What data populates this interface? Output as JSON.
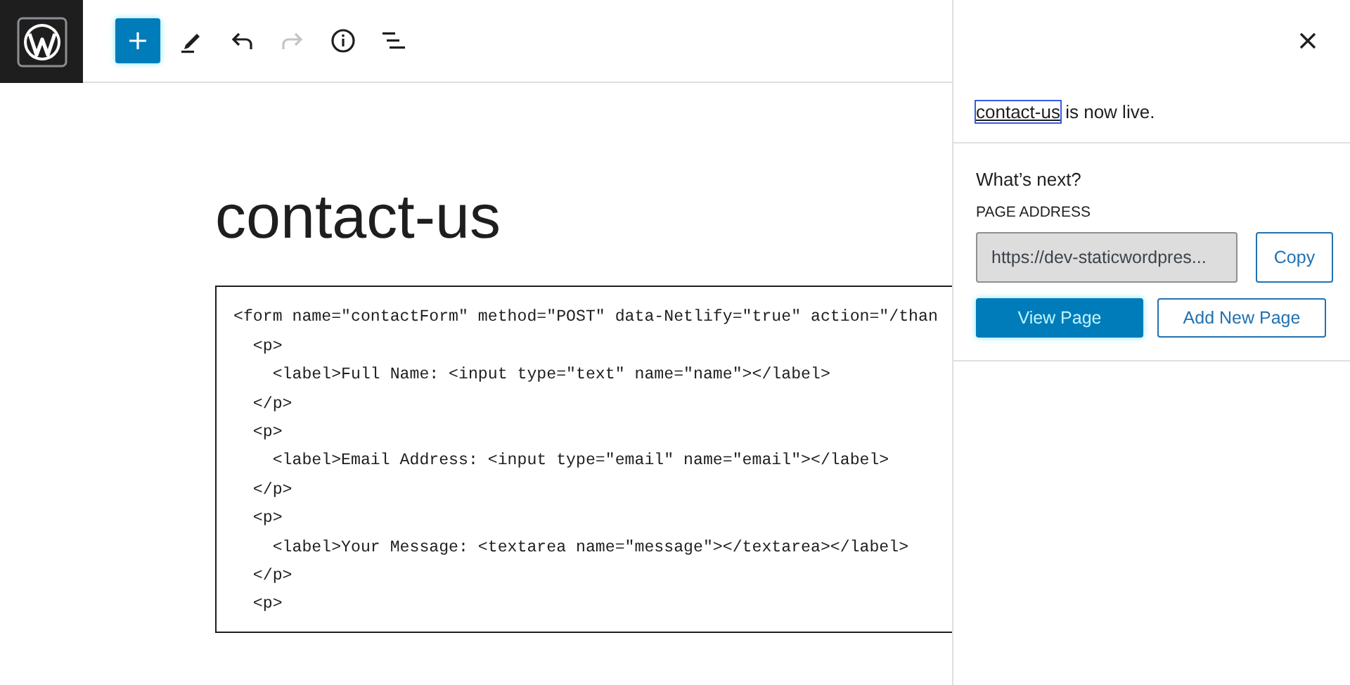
{
  "toolbar": {
    "tools": [
      {
        "kind": "add",
        "disabled": false
      },
      {
        "kind": "edit",
        "disabled": false
      },
      {
        "kind": "undo",
        "disabled": false
      },
      {
        "kind": "redo",
        "disabled": true
      },
      {
        "kind": "info",
        "disabled": false
      },
      {
        "kind": "list",
        "disabled": false
      }
    ]
  },
  "editor": {
    "title": "contact-us",
    "code_lines": [
      "<form name=\"contactForm\" method=\"POST\" data-Netlify=\"true\" action=\"/than",
      "  <p>",
      "    <label>Full Name: <input type=\"text\" name=\"name\"></label>",
      "  </p>",
      "  <p>",
      "    <label>Email Address: <input type=\"email\" name=\"email\"></label>",
      "  </p>",
      "  <p>",
      "    <label>Your Message: <textarea name=\"message\"></textarea></label>",
      "  </p>",
      "  <p>"
    ]
  },
  "sidebar": {
    "notice": {
      "link": "contact-us",
      "text": "is now live."
    },
    "heading": "What’s next?",
    "address_label": "PAGE ADDRESS",
    "address": {
      "value": "https://dev-staticwordpres..."
    },
    "copy_button": "Copy",
    "actions": [
      {
        "label": "View Page",
        "kind": "primary"
      },
      {
        "label": "Add New Page",
        "kind": "secondary"
      }
    ]
  }
}
